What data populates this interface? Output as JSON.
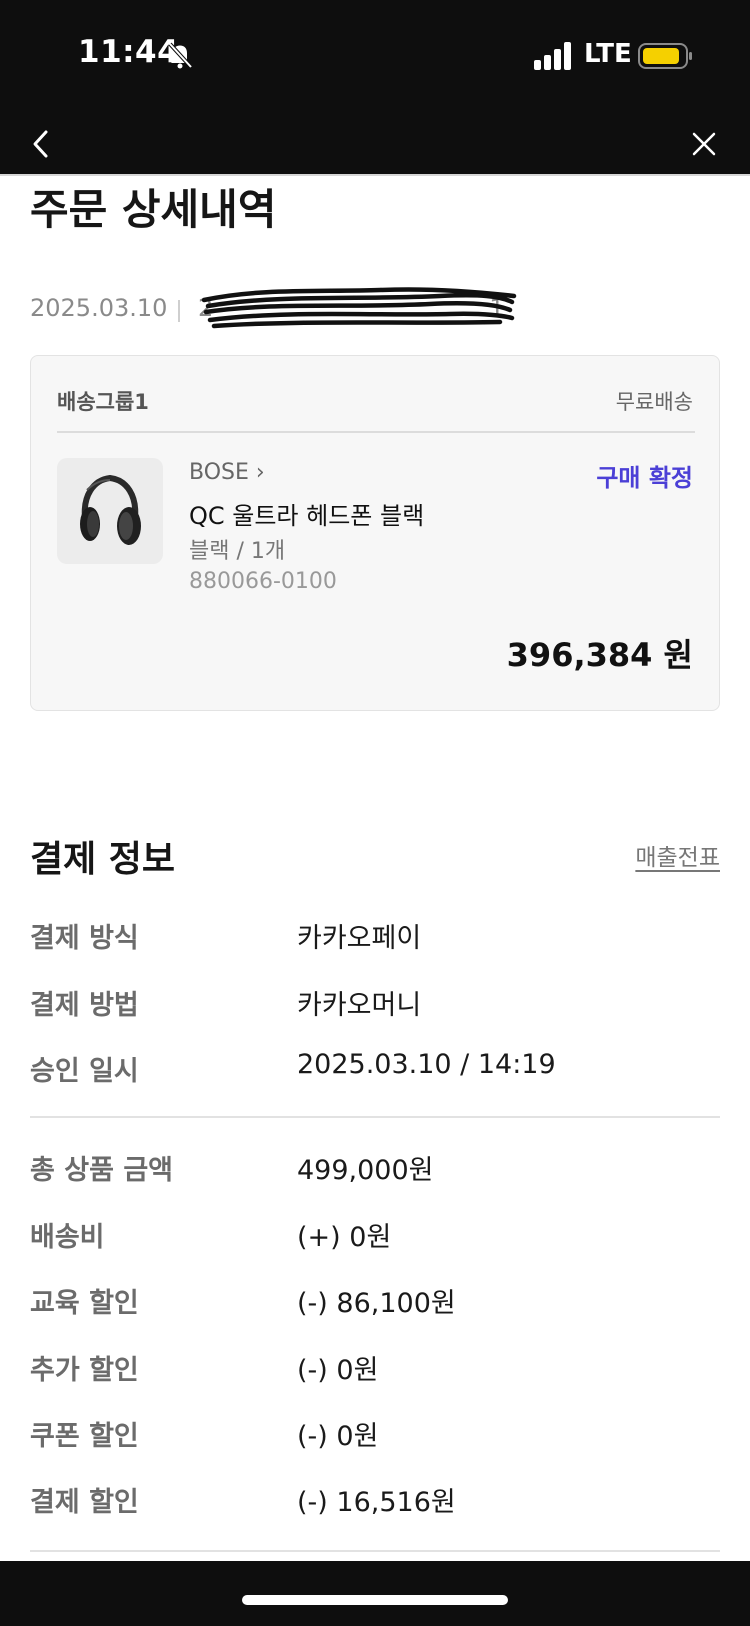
{
  "status_bar": {
    "time": "11:44",
    "network": "LTE",
    "icons": [
      "bell-slash-icon",
      "signal-icon",
      "battery-icon"
    ],
    "battery_color": "#f5d000"
  },
  "nav": {
    "back_icon": "chevron-left-icon",
    "close_icon": "close-icon"
  },
  "page_title": "주문 상세내역",
  "order": {
    "date": "2025.03.10",
    "number_fragment_start": "2",
    "number_fragment_end": "1"
  },
  "shipment_group": {
    "label": "배송그룹1",
    "shipping_type": "무료배송",
    "item": {
      "brand": "BOSE",
      "brand_arrow": "›",
      "status": "구매 확정",
      "status_color": "#4b3fd6",
      "name": "QC 울트라 헤드폰 블랙",
      "option": "블랙 / 1개",
      "sku": "880066-0100",
      "price": "396,384 원",
      "thumbnail": "headphones-image"
    }
  },
  "payment": {
    "title": "결제 정보",
    "receipt_link": "매출전표",
    "method_rows": [
      {
        "label": "결제 방식",
        "value": "카카오페이"
      },
      {
        "label": "결제 방법",
        "value": "카카오머니"
      },
      {
        "label": "승인 일시",
        "value": "2025.03.10 / 14:19"
      }
    ],
    "amount_rows": [
      {
        "label": "총 상품 금액",
        "value": "499,000원"
      },
      {
        "label": "배송비",
        "value": "(+) 0원"
      },
      {
        "label": "교육 할인",
        "value": "(-) 86,100원"
      },
      {
        "label": "추가 할인",
        "value": "(-) 0원"
      },
      {
        "label": "쿠폰 할인",
        "value": "(-) 0원"
      },
      {
        "label": "결제 할인",
        "value": "(-) 16,516원"
      }
    ]
  }
}
